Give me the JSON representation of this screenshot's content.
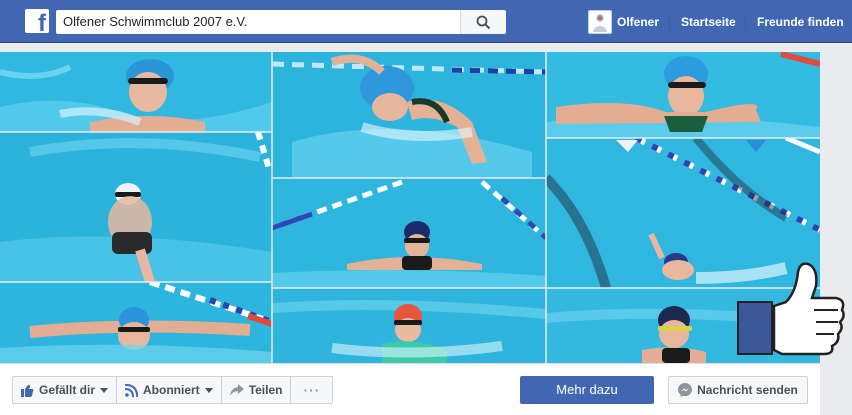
{
  "topbar": {
    "search_value": "Olfener Schwimmclub 2007 e.V.",
    "profile_name": "Olfener",
    "nav_home": "Startseite",
    "nav_find_friends": "Freunde finden",
    "colors": {
      "bar": "#4267b2",
      "button": "#4267b2"
    }
  },
  "cover": {
    "description_icons": [
      "swimmer-photo-collage",
      "like-thumbs-up-icon"
    ]
  },
  "actions": {
    "like_label": "Gefällt dir",
    "follow_label": "Abonniert",
    "share_label": "Teilen",
    "more_label": "···",
    "learn_more_label": "Mehr dazu",
    "message_label": "Nachricht senden"
  }
}
